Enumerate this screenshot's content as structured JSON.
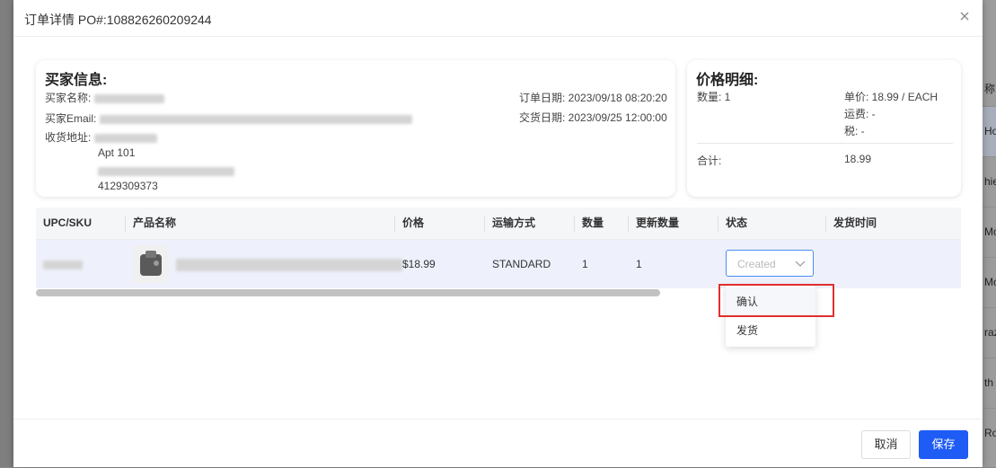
{
  "modal": {
    "title": "订单详情 PO#:108826260209244"
  },
  "buyer": {
    "title": "买家信息:",
    "name_label": "买家名称:",
    "email_label": "买家Email:",
    "address_label": "收货地址:",
    "address_line2": "Apt 101",
    "phone": "4129309373",
    "order_date": "订单日期: 2023/09/18 08:20:20",
    "delivery_date": "交货日期: 2023/09/25 12:00:00"
  },
  "price": {
    "title": "价格明细:",
    "qty": "数量: 1",
    "unit_price": "单价: 18.99 / EACH",
    "shipping": "运费: -",
    "tax": "税: -",
    "total_label": "合计:",
    "total_value": "18.99"
  },
  "table": {
    "headers": [
      "UPC/SKU",
      "产品名称",
      "价格",
      "运输方式",
      "数量",
      "更新数量",
      "状态",
      "发货时间"
    ],
    "row": {
      "price": "$18.99",
      "shipping": "STANDARD",
      "qty": "1",
      "update_qty": "1"
    }
  },
  "status_select": {
    "value": "Created",
    "options": [
      "确认",
      "发货"
    ]
  },
  "footer": {
    "cancel": "取消",
    "save": "保存"
  },
  "background": {
    "fragments": [
      "称",
      "Hor",
      "hie",
      "Mor",
      "Mc",
      "raz",
      "th I",
      "Ro"
    ]
  },
  "colors": {
    "primary": "#1e5cf5",
    "highlight": "#e02f2f",
    "select_border": "#4a8cf5"
  }
}
